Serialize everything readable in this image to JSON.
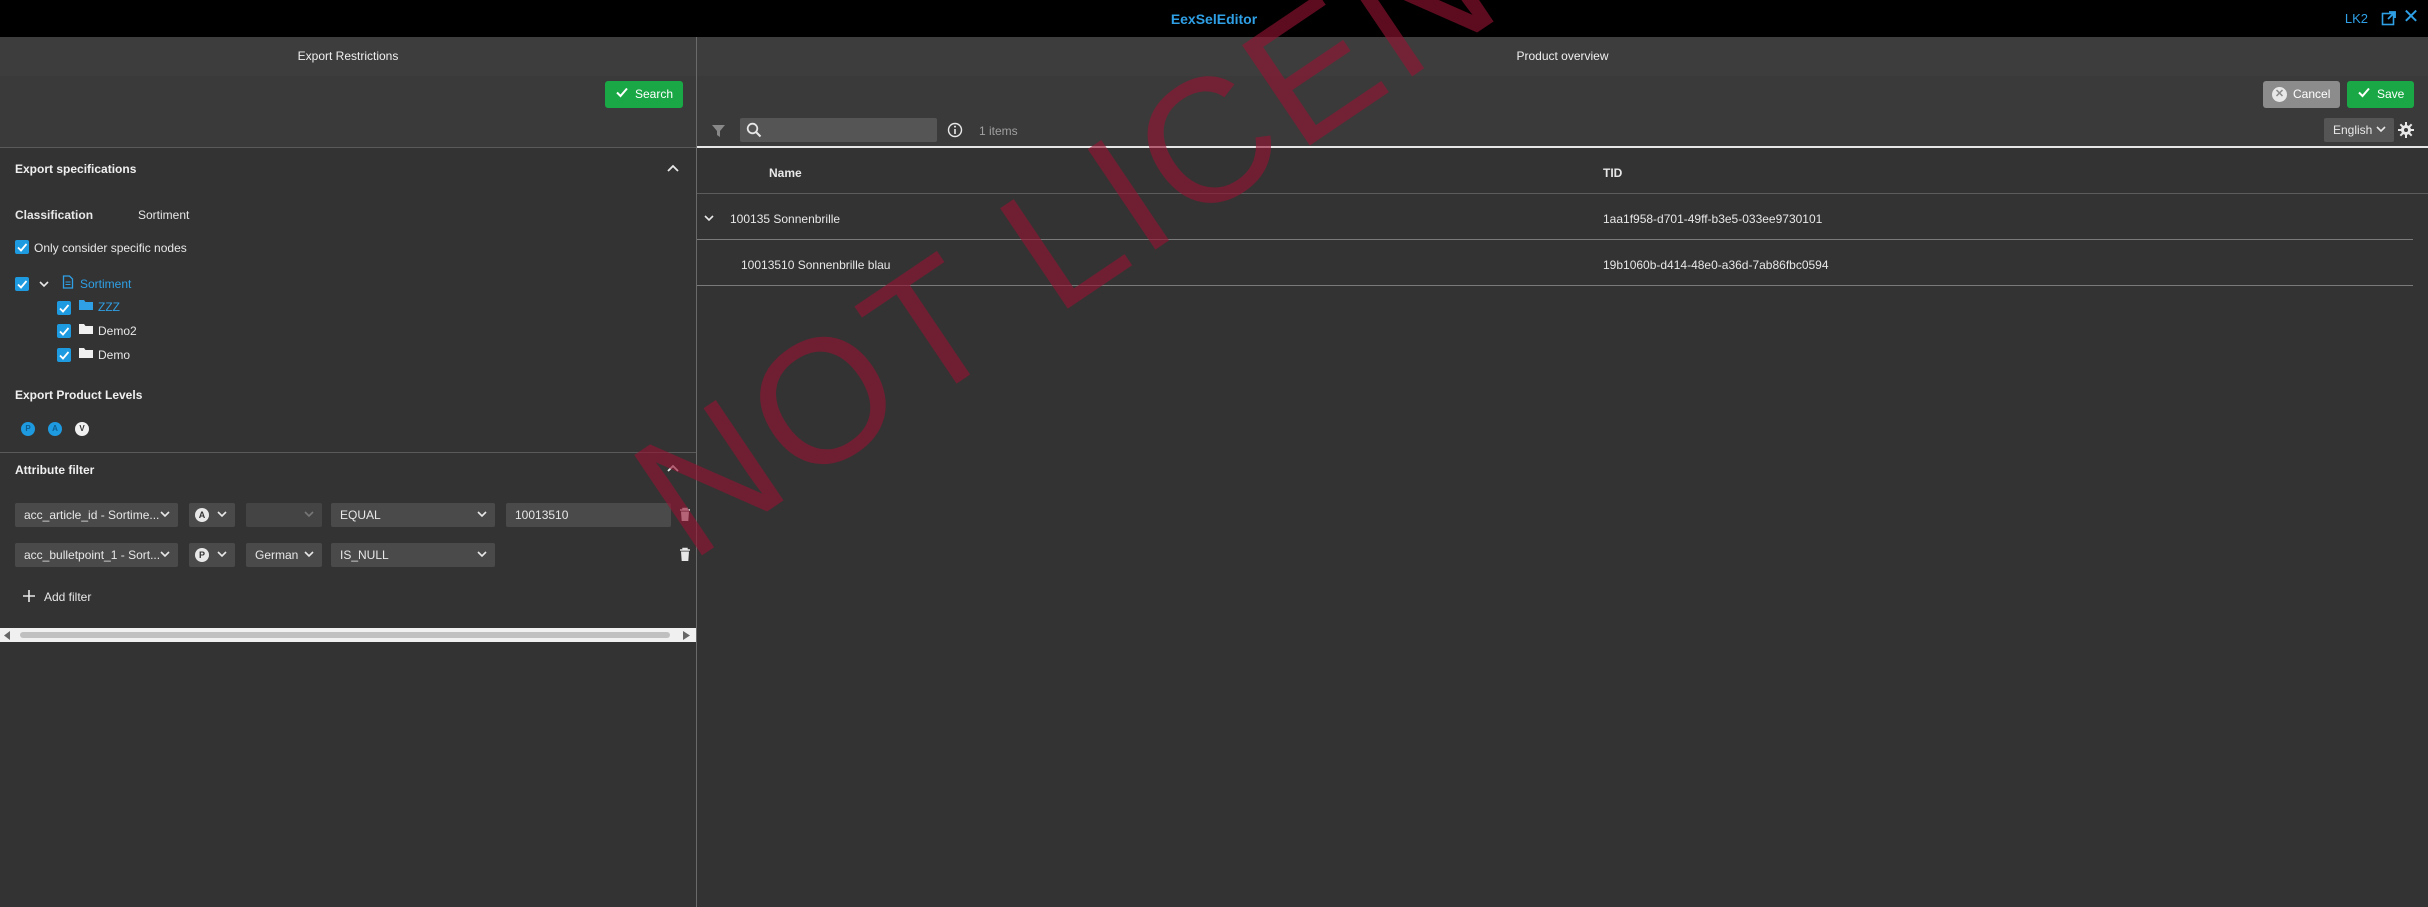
{
  "titlebar": {
    "title": "EexSelEditor",
    "user": "LK2"
  },
  "left_panel": {
    "header": "Export Restrictions",
    "search_button": "Search",
    "export_specs": {
      "title": "Export specifications",
      "classification_label": "Classification",
      "classification_value": "Sortiment",
      "only_specific_nodes": "Only consider specific nodes",
      "tree": {
        "root": "Sortiment",
        "children": [
          "ZZZ",
          "Demo2",
          "Demo"
        ]
      },
      "product_levels_title": "Export Product Levels",
      "product_levels": [
        "P",
        "A",
        "V"
      ]
    },
    "attribute_filter": {
      "title": "Attribute filter",
      "filters": [
        {
          "attribute": "acc_article_id - Sortime...",
          "level": "A",
          "language": "",
          "operator": "EQUAL",
          "value": "10013510"
        },
        {
          "attribute": "acc_bulletpoint_1 - Sort...",
          "level": "P",
          "language": "German",
          "operator": "IS_NULL",
          "value": ""
        }
      ],
      "add_filter": "Add filter"
    }
  },
  "right_panel": {
    "header": "Product overview",
    "cancel_button": "Cancel",
    "save_button": "Save",
    "search_placeholder": "",
    "item_count": "1 items",
    "language": "English",
    "columns": [
      "Name",
      "TID"
    ],
    "rows": [
      {
        "name": "100135 Sonnenbrille",
        "tid": "1aa1f958-d701-49ff-b3e5-033ee9730101",
        "expanded": true
      },
      {
        "name": "10013510 Sonnenbrille blau",
        "tid": "19b1060b-d414-48e0-a36d-7ab86fbc0594",
        "expanded": false
      }
    ]
  },
  "watermark": "NOT LICENSED",
  "colors": {
    "accent_blue": "#2fa0e6",
    "green": "#1aa846",
    "background": "#333333",
    "watermark": "#96143e"
  }
}
